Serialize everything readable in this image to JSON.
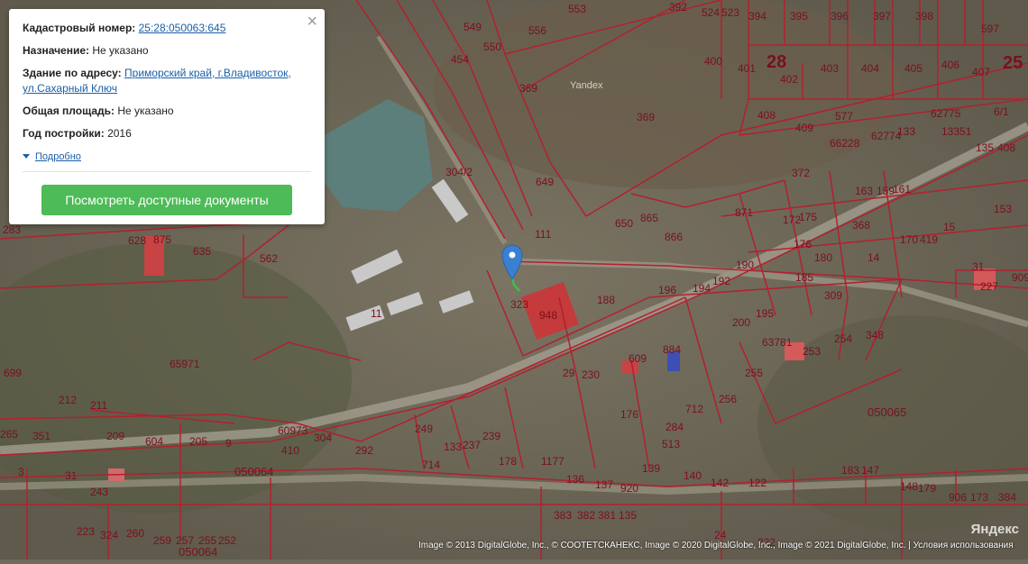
{
  "popup": {
    "close_label": "×",
    "cadastral_label": "Кадастровый номер:",
    "cadastral_value": "25:28:050063:645",
    "purpose_label": "Назначение:",
    "purpose_value": "Не указано",
    "address_label": "Здание по адресу:",
    "address_value": "Приморский край, г.Владивосток, ул.Сахарный Ключ",
    "area_label": "Общая площадь:",
    "area_value": "Не указано",
    "year_label": "Год постройки:",
    "year_value": "2016",
    "more_label": "Подробно",
    "button_label": "Посмотреть доступные документы",
    "button_color": "#4dbb57",
    "link_color": "#1a5fa8"
  },
  "map": {
    "boundary_color": "#b3202e",
    "label_color": "#7a1020",
    "watermark": "Yandex",
    "quarter_labels": [
      "28",
      "25"
    ],
    "area_labels": [
      "050065",
      "050064",
      "050064"
    ],
    "plot_labels": [
      "553",
      "392",
      "524",
      "523",
      "394",
      "395",
      "396",
      "397",
      "398",
      "597",
      "549",
      "556",
      "400",
      "401",
      "402",
      "403",
      "404",
      "405",
      "406",
      "407",
      "454",
      "550",
      "369",
      "369",
      "408",
      "577",
      "62775",
      "6/1",
      "409",
      "66228",
      "62774",
      "133",
      "13351",
      "135",
      "408",
      "304/2",
      "649",
      "372",
      "871",
      "172",
      "175",
      "159",
      "163",
      "161",
      "153",
      "111",
      "650",
      "865",
      "866",
      "176",
      "368",
      "170",
      "419",
      "15",
      "31",
      "628",
      "875",
      "635",
      "562",
      "180",
      "14",
      "323",
      "948",
      "188",
      "196",
      "194",
      "192",
      "190",
      "185",
      "309",
      "227",
      "909",
      "283",
      "11",
      "609",
      "884",
      "200",
      "195",
      "63781",
      "253",
      "254",
      "348",
      "699",
      "65971",
      "29",
      "230",
      "255",
      "256",
      "60973",
      "212",
      "211",
      "351",
      "209",
      "604",
      "205",
      "9",
      "410",
      "304",
      "292",
      "249",
      "237",
      "239",
      "133",
      "178",
      "1177",
      "176",
      "284",
      "712",
      "513",
      "265",
      "3",
      "31",
      "243",
      "714",
      "139",
      "140",
      "142",
      "122",
      "183",
      "147",
      "148",
      "179",
      "906",
      "173",
      "384",
      "383",
      "382",
      "381",
      "135",
      "136",
      "137",
      "920",
      "24",
      "222",
      "223",
      "324",
      "260",
      "259",
      "257",
      "255",
      "252"
    ],
    "pin_color": "#3a7fd0"
  },
  "attribution": {
    "copyright": "Image © 2013 DigitalGlobe, Inc., © СООТЕТСКАНЕКС, Image © 2020 DigitalGlobe, Inc., Image © 2021 DigitalGlobe, Inc. | Условия использования",
    "logo": "Яндекс"
  }
}
